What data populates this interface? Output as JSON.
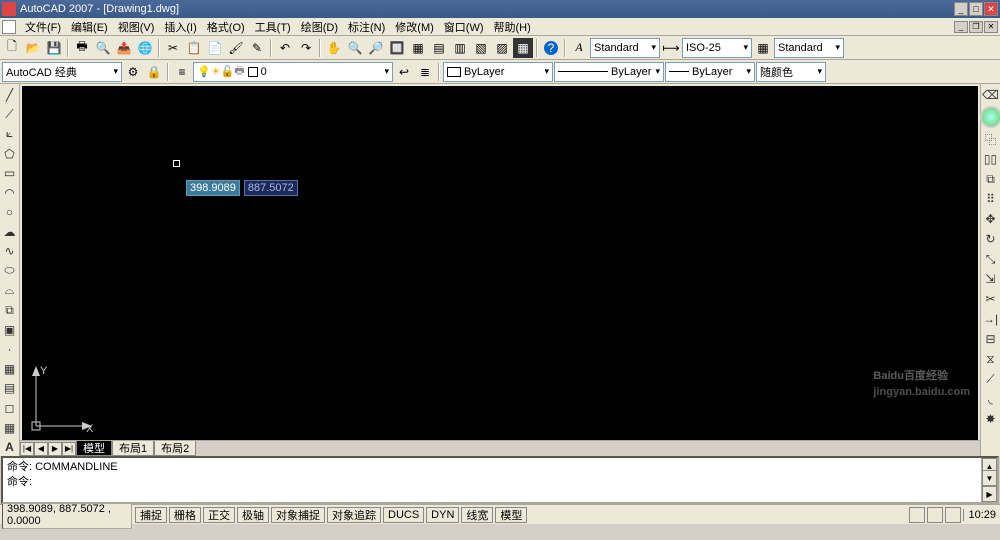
{
  "app": {
    "name": "AutoCAD 2007",
    "doc": "[Drawing1.dwg]"
  },
  "menu": [
    "文件(F)",
    "编辑(E)",
    "视图(V)",
    "插入(I)",
    "格式(O)",
    "工具(T)",
    "绘图(D)",
    "标注(N)",
    "修改(M)",
    "窗口(W)",
    "帮助(H)"
  ],
  "toolbar2": {
    "textstyle": "Standard",
    "dimstyle": "ISO-25",
    "tablestyle": "Standard"
  },
  "toolbar3": {
    "workspace": "AutoCAD 经典",
    "layer": "0",
    "bylayer1": "ByLayer",
    "bylayer2": "ByLayer",
    "bylayer3": "ByLayer",
    "color": "随颜色"
  },
  "dynamic_input": {
    "x": "398.9089",
    "y": "887.5072"
  },
  "ucs": {
    "x": "X",
    "y": "Y"
  },
  "tabs": {
    "nav": [
      "|◀",
      "◀",
      "▶",
      "▶|"
    ],
    "items": [
      "模型",
      "布局1",
      "布局2"
    ],
    "active": 0
  },
  "cmd": {
    "line1": "命令: COMMANDLINE",
    "line2": "命令:"
  },
  "status": {
    "coords": "398.9089, 887.5072 , 0.0000",
    "toggles": [
      "捕捉",
      "栅格",
      "正交",
      "极轴",
      "对象捕捉",
      "对象追踪",
      "DUCS",
      "DYN",
      "线宽",
      "模型"
    ],
    "time": "10:29"
  },
  "watermark": {
    "main": "Baidu百度经验",
    "sub": "jingyan.baidu.com"
  }
}
